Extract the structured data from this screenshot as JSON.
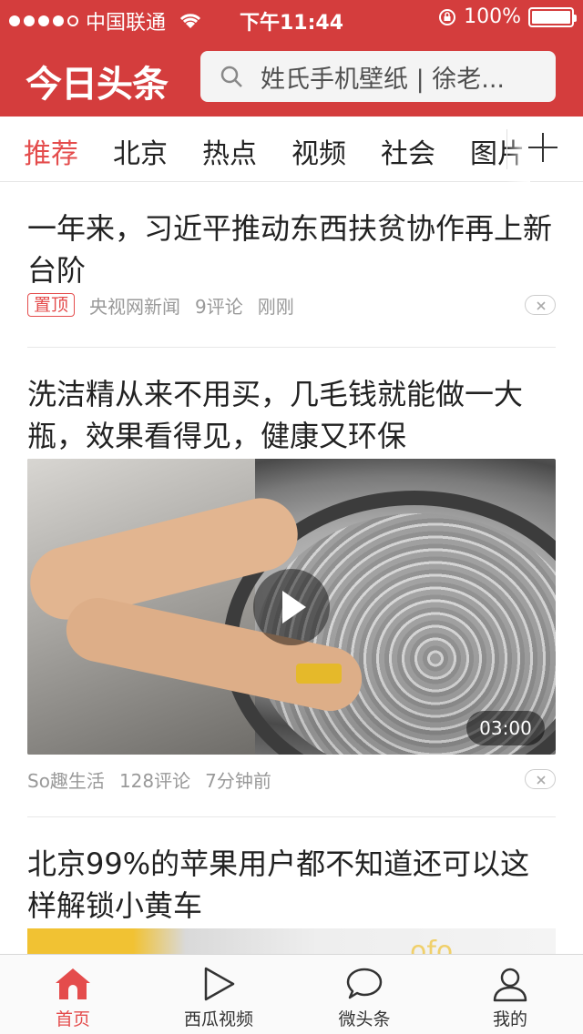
{
  "status_bar": {
    "carrier": "中国联通",
    "time": "下午11:44",
    "battery": "100%",
    "signal_bars_filled": 4,
    "signal_bars_total": 5
  },
  "header": {
    "logo": "今日头条",
    "search_placeholder": "姓氏手机壁纸 | 徐老...",
    "accent_color": "#d43d3d"
  },
  "channels": [
    "推荐",
    "北京",
    "热点",
    "视频",
    "社会",
    "图片"
  ],
  "active_channel": "推荐",
  "articles": [
    {
      "title": "一年来，习近平推动东西扶贫协作再上新台阶",
      "pinned_label": "置顶",
      "source": "央视网新闻",
      "comments": "9评论",
      "time": "刚刚"
    },
    {
      "title": "洗洁精从来不用买，几毛钱就能做一大瓶，效果看得见，健康又环保",
      "source": "So趣生活",
      "comments": "128评论",
      "time": "7分钟前",
      "video_duration": "03:00"
    },
    {
      "title": "北京99%的苹果用户都不知道还可以这样解锁小黄车"
    }
  ],
  "tabbar": {
    "items": [
      "首页",
      "西瓜视频",
      "微头条",
      "我的"
    ],
    "active": "首页"
  }
}
